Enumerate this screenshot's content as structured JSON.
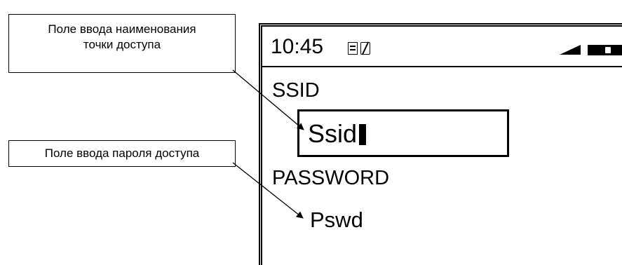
{
  "callouts": {
    "ssid_field_line1": "Поле ввода наименования",
    "ssid_field_line2": "точки доступа",
    "password_field": "Поле ввода пароля доступа"
  },
  "statusbar": {
    "time": "10:45",
    "icons": [
      "wifi-settings-icon",
      "edit-mode-icon",
      "signal-strength-icon",
      "battery-icon"
    ]
  },
  "form": {
    "ssid_label": "SSID",
    "ssid_value": "Ssid",
    "password_label": "PASSWORD",
    "password_value": "Pswd"
  },
  "colors": {
    "foreground": "#000000",
    "background": "#ffffff"
  }
}
